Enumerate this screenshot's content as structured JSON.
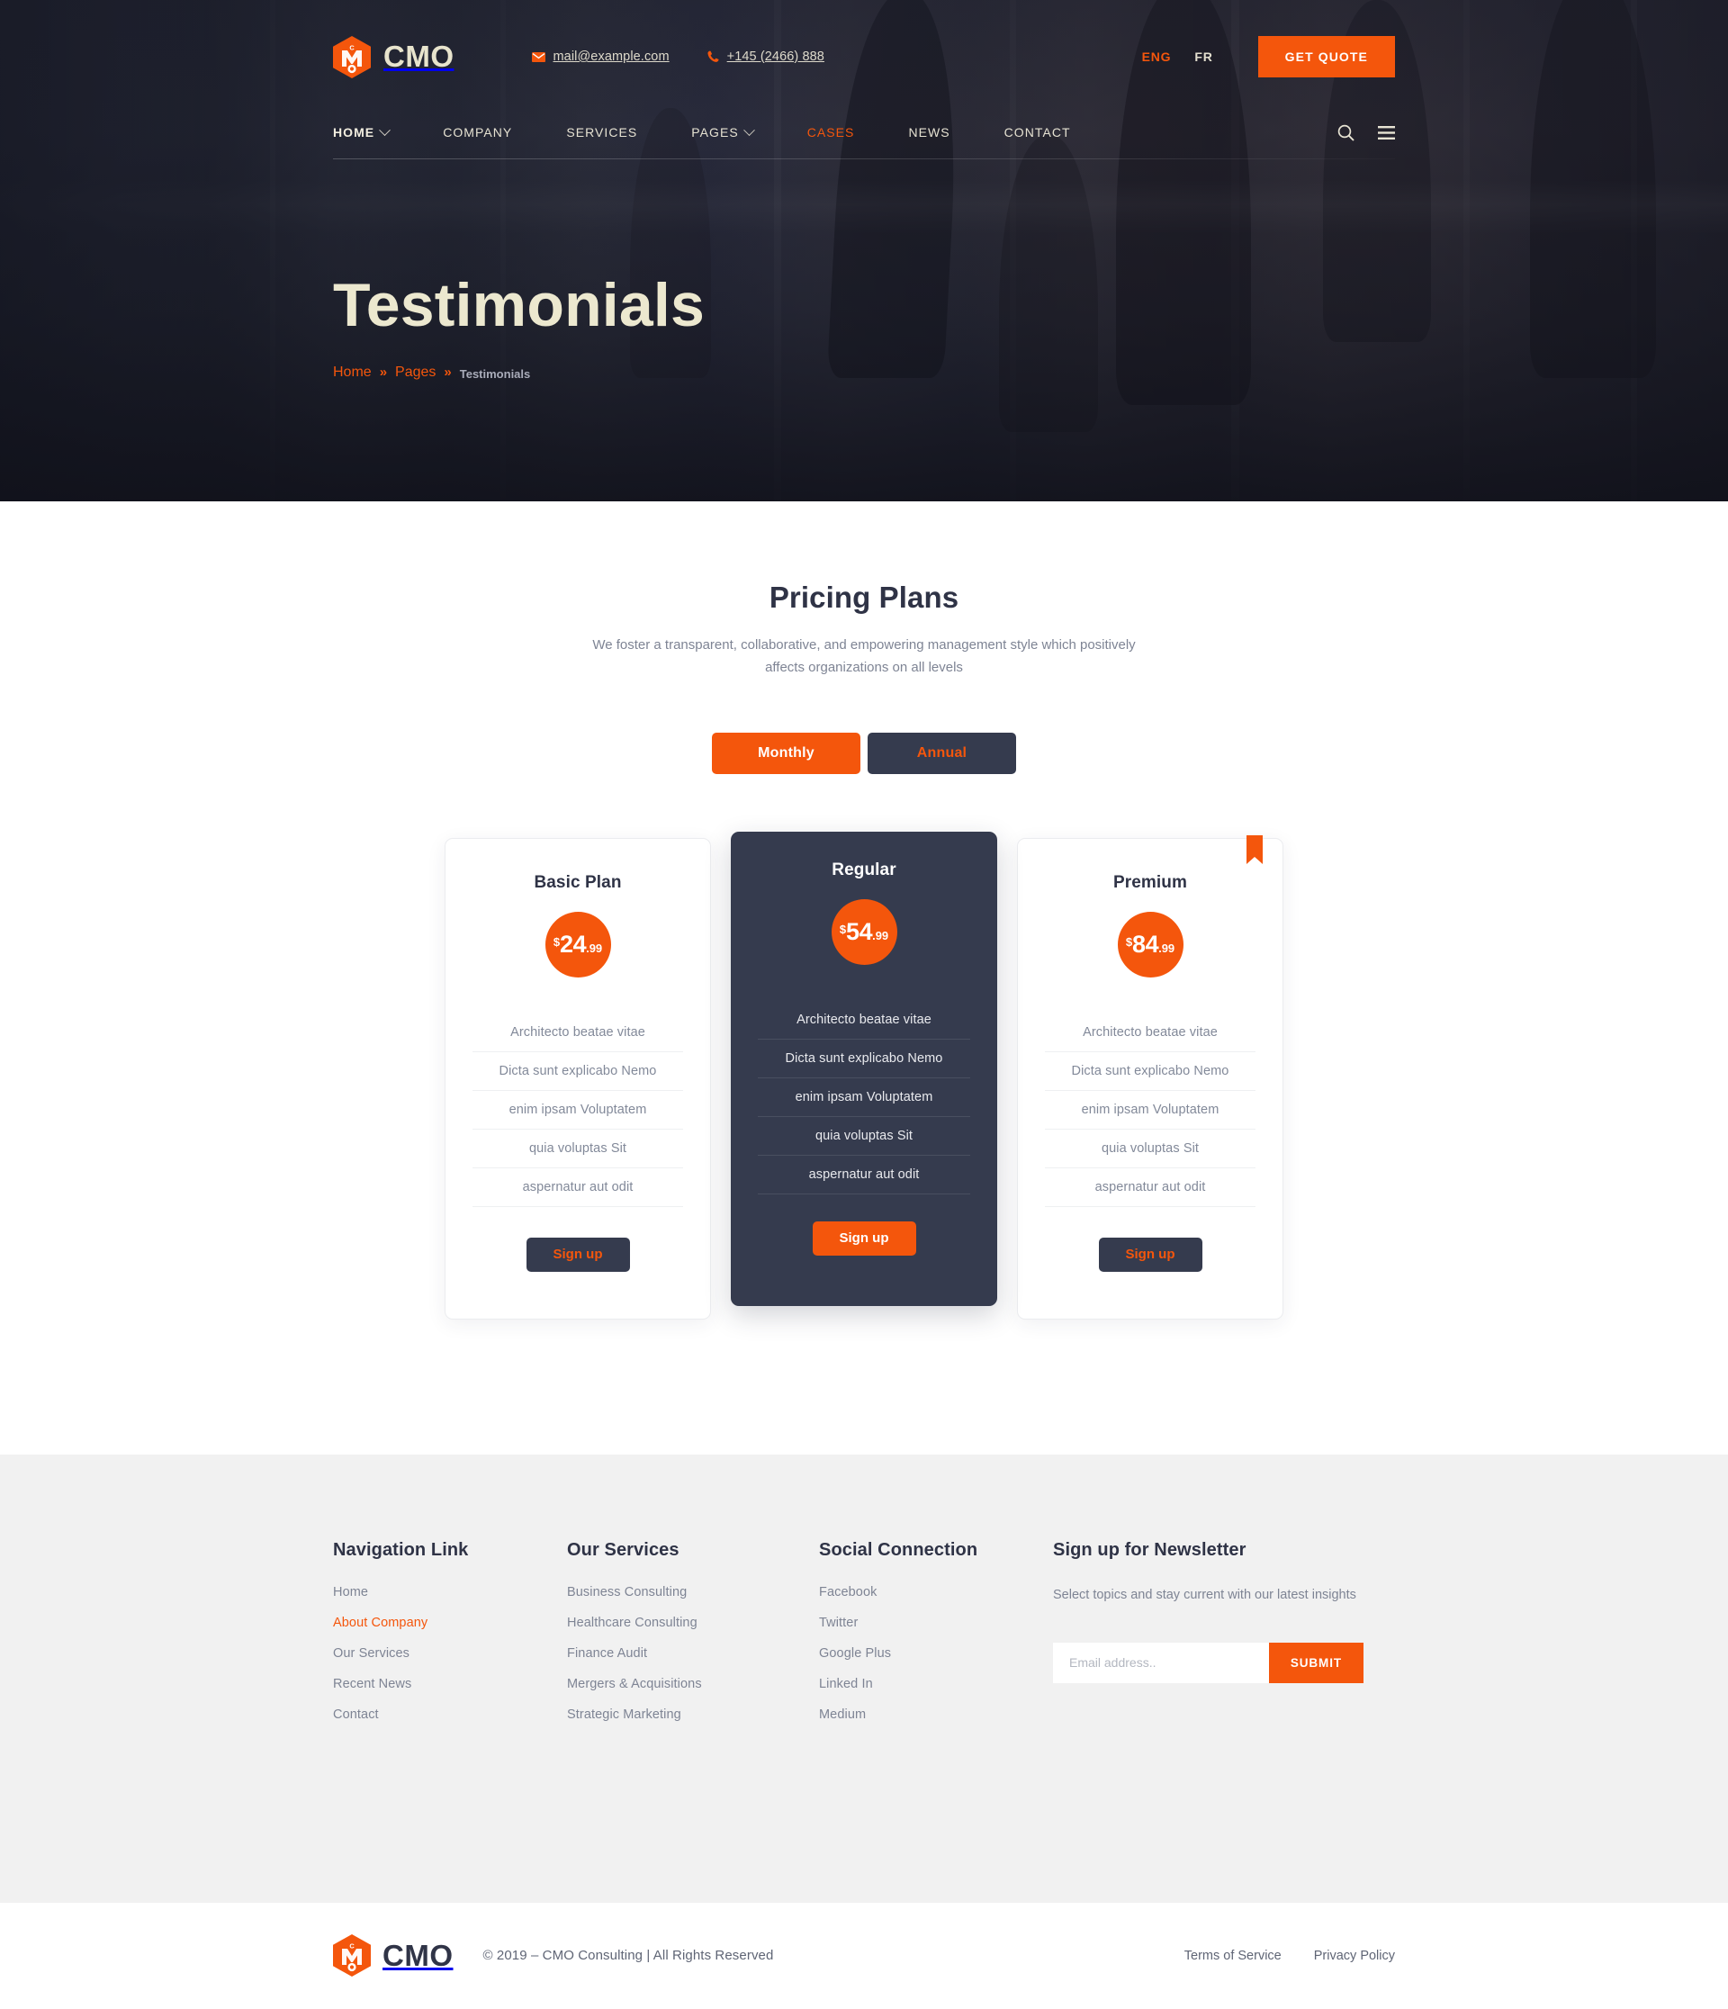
{
  "brand": {
    "name": "CMO",
    "accent": "#f4560c",
    "dark": "#353b4e",
    "cream": "#e8e4cd"
  },
  "header": {
    "email": "mail@example.com",
    "email_icon": "envelope-icon",
    "phone": "+145 (2466) 888",
    "phone_icon": "phone-icon",
    "languages": [
      {
        "code": "ENG",
        "active": true
      },
      {
        "code": "FR",
        "active": false
      }
    ],
    "quote_button": "GET QUOTE",
    "search_icon": "search-icon",
    "menu_icon": "hamburger-menu-icon",
    "nav": [
      {
        "label": "HOME",
        "has_dropdown": true,
        "bold": true,
        "active": false
      },
      {
        "label": "COMPANY",
        "has_dropdown": false,
        "bold": false,
        "active": false
      },
      {
        "label": "SERVICES",
        "has_dropdown": false,
        "bold": false,
        "active": false
      },
      {
        "label": "PAGES",
        "has_dropdown": true,
        "bold": false,
        "active": false
      },
      {
        "label": "CASES",
        "has_dropdown": false,
        "bold": false,
        "active": true
      },
      {
        "label": "NEWS",
        "has_dropdown": false,
        "bold": false,
        "active": false
      },
      {
        "label": "CONTACT",
        "has_dropdown": false,
        "bold": false,
        "active": false
      }
    ]
  },
  "hero": {
    "title": "Testimonials",
    "breadcrumb": [
      {
        "label": "Home",
        "link": true
      },
      {
        "label": "Pages",
        "link": true
      },
      {
        "label": "Testimonials",
        "link": false
      }
    ],
    "separator": "»"
  },
  "pricing": {
    "title": "Pricing Plans",
    "subtitle": "We foster a transparent, collaborative, and empowering management style which positively affects organizations on all levels",
    "billing_toggle": [
      {
        "label": "Monthly",
        "active": true
      },
      {
        "label": "Annual",
        "active": false
      }
    ],
    "plans": [
      {
        "name": "Basic Plan",
        "currency": "$",
        "amount": "24",
        "decimals": ".99",
        "featured": false,
        "badge": false,
        "cta": "Sign up",
        "features": [
          "Architecto beatae vitae",
          "Dicta sunt explicabo Nemo",
          "enim ipsam Voluptatem",
          "quia voluptas Sit",
          "aspernatur aut odit"
        ]
      },
      {
        "name": "Regular",
        "currency": "$",
        "amount": "54",
        "decimals": ".99",
        "featured": true,
        "badge": false,
        "cta": "Sign up",
        "features": [
          "Architecto beatae vitae",
          "Dicta sunt explicabo Nemo",
          "enim ipsam Voluptatem",
          "quia voluptas Sit",
          "aspernatur aut odit"
        ]
      },
      {
        "name": "Premium",
        "currency": "$",
        "amount": "84",
        "decimals": ".99",
        "featured": false,
        "badge": true,
        "badge_icon": "bookmark-ribbon-icon",
        "cta": "Sign up",
        "features": [
          "Architecto beatae vitae",
          "Dicta sunt explicabo Nemo",
          "enim ipsam Voluptatem",
          "quia voluptas Sit",
          "aspernatur aut odit"
        ]
      }
    ]
  },
  "footer": {
    "columns": [
      {
        "title": "Navigation Link",
        "links": [
          {
            "label": "Home",
            "active": false
          },
          {
            "label": "About Company",
            "active": true
          },
          {
            "label": "Our Services",
            "active": false
          },
          {
            "label": "Recent News",
            "active": false
          },
          {
            "label": "Contact",
            "active": false
          }
        ]
      },
      {
        "title": "Our Services",
        "links": [
          {
            "label": "Business Consulting",
            "active": false
          },
          {
            "label": "Healthcare Consulting",
            "active": false
          },
          {
            "label": "Finance Audit",
            "active": false
          },
          {
            "label": "Mergers & Acquisitions",
            "active": false
          },
          {
            "label": "Strategic Marketing",
            "active": false
          }
        ]
      },
      {
        "title": "Social Connection",
        "links": [
          {
            "label": "Facebook",
            "active": false
          },
          {
            "label": "Twitter",
            "active": false
          },
          {
            "label": "Google Plus",
            "active": false
          },
          {
            "label": "Linked In",
            "active": false
          },
          {
            "label": "Medium",
            "active": false
          }
        ]
      }
    ],
    "newsletter": {
      "title": "Sign up for Newsletter",
      "description": "Select topics and stay current with our latest insights",
      "placeholder": "Email address..",
      "value": "",
      "submit": "SUBMIT"
    }
  },
  "bottom": {
    "logo_name": "CMO",
    "copyright": "© 2019 – CMO Consulting | All Rights Reserved",
    "links": [
      {
        "label": "Terms of Service"
      },
      {
        "label": "Privacy Policy"
      }
    ]
  }
}
